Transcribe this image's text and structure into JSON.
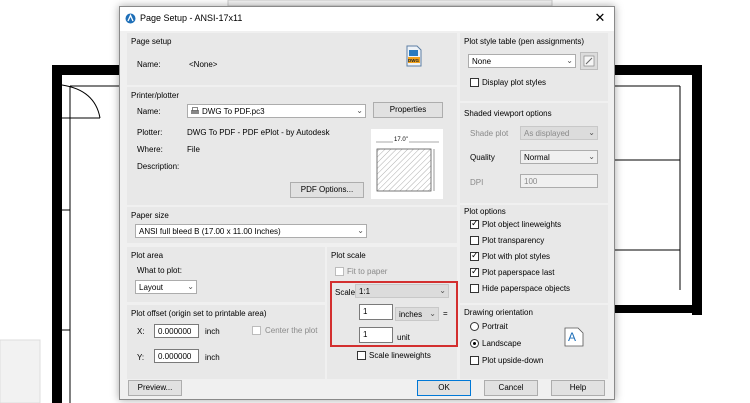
{
  "dialog": {
    "title": "Page Setup - ANSI-17x11",
    "close_glyph": "✕"
  },
  "page_setup": {
    "header": "Page setup",
    "name_label": "Name:",
    "name_value": "<None>",
    "badge": "DWG"
  },
  "printer": {
    "header": "Printer/plotter",
    "name_label": "Name:",
    "name_value": "DWG To PDF.pc3",
    "properties_button": "Properties",
    "plotter_label": "Plotter:",
    "plotter_value": "DWG To PDF - PDF ePlot - by Autodesk",
    "where_label": "Where:",
    "where_value": "File",
    "description_label": "Description:",
    "pdf_options_button": "PDF Options...",
    "preview_width": "17.0\""
  },
  "paper_size": {
    "header": "Paper size",
    "value": "ANSI full bleed B (17.00 x 11.00 Inches)"
  },
  "plot_area": {
    "header": "Plot area",
    "what_label": "What to plot:",
    "what_value": "Layout"
  },
  "plot_offset": {
    "header": "Plot offset (origin set to printable area)",
    "x_label": "X:",
    "x_value": "0.000000",
    "x_unit": "inch",
    "y_label": "Y:",
    "y_value": "0.000000",
    "y_unit": "inch",
    "center_label": "Center the plot"
  },
  "plot_scale": {
    "header": "Plot scale",
    "fit_label": "Fit to paper",
    "scale_label": "Scale:",
    "scale_value": "1:1",
    "inches_value": "1",
    "inches_unit": "inches",
    "equals": "=",
    "unit_value": "1",
    "unit_label": "unit",
    "lineweights_label": "Scale lineweights"
  },
  "plot_style": {
    "header": "Plot style table (pen assignments)",
    "value": "None",
    "display_label": "Display plot styles"
  },
  "shaded": {
    "header": "Shaded viewport options",
    "shade_label": "Shade plot",
    "shade_value": "As displayed",
    "quality_label": "Quality",
    "quality_value": "Normal",
    "dpi_label": "DPI",
    "dpi_value": "100"
  },
  "plot_options": {
    "header": "Plot options",
    "items": [
      {
        "label": "Plot object lineweights",
        "checked": true
      },
      {
        "label": "Plot transparency",
        "checked": false
      },
      {
        "label": "Plot with plot styles",
        "checked": true
      },
      {
        "label": "Plot paperspace last",
        "checked": true
      },
      {
        "label": "Hide paperspace objects",
        "checked": false
      }
    ]
  },
  "orientation": {
    "header": "Drawing orientation",
    "portrait": "Portrait",
    "landscape": "Landscape",
    "upside_down": "Plot upside-down",
    "letter": "A"
  },
  "buttons": {
    "preview": "Preview...",
    "ok": "OK",
    "cancel": "Cancel",
    "help": "Help"
  },
  "colors": {
    "highlight": "#d32f2f",
    "focus_blue": "#0078d7"
  }
}
